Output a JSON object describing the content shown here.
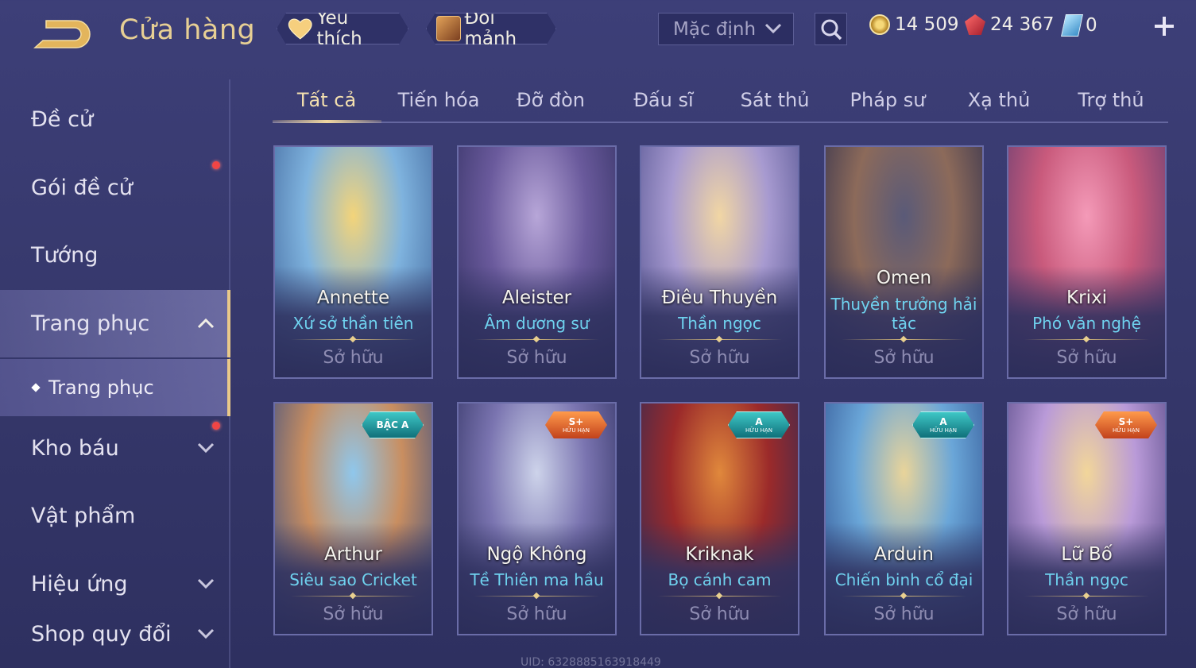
{
  "header": {
    "title": "Cửa hàng",
    "favorites_label": "Yêu thích",
    "exchange_label": "Đổi mảnh",
    "sort_value": "Mặc định",
    "gold": "14 509",
    "gems": "24 367",
    "vouchers": "0"
  },
  "sidebar": {
    "items": [
      {
        "label": "Đề cử"
      },
      {
        "label": "Gói đề cử"
      },
      {
        "label": "Tướng"
      },
      {
        "label": "Trang phục"
      },
      {
        "label": "Kho báu"
      },
      {
        "label": "Vật phẩm"
      },
      {
        "label": "Hiệu ứng"
      },
      {
        "label": "Shop quy đổi"
      }
    ],
    "subitem": "Trang phục"
  },
  "tabs": [
    "Tất cả",
    "Tiến hóa",
    "Đỡ đòn",
    "Đấu sĩ",
    "Sát thủ",
    "Pháp sư",
    "Xạ thủ",
    "Trợ thủ"
  ],
  "active_tab": "Tất cả",
  "cards": [
    {
      "hero": "Annette",
      "skin": "Xứ sở thần tiên",
      "status": "Sở hữu",
      "badge": null,
      "art": [
        "#f3d47a",
        "#7fb3de",
        "#3b5f96"
      ]
    },
    {
      "hero": "Aleister",
      "skin": "Âm dương sư",
      "status": "Sở hữu",
      "badge": null,
      "art": [
        "#b7a6d8",
        "#6a5a9c",
        "#2f2e5f"
      ]
    },
    {
      "hero": "Điêu Thuyền",
      "skin": "Thần ngọc",
      "status": "Sở hữu",
      "badge": null,
      "art": [
        "#f1d6a4",
        "#a79ad0",
        "#4b4c8a"
      ]
    },
    {
      "hero": "Omen",
      "skin": "Thuyền trưởng hải tặc",
      "status": "Sở hữu",
      "badge": null,
      "art": [
        "#5a5a78",
        "#8c6a5a",
        "#272a4c"
      ]
    },
    {
      "hero": "Krixi",
      "skin": "Phó văn nghệ",
      "status": "Sở hữu",
      "badge": null,
      "art": [
        "#f49ab8",
        "#c95a7c",
        "#5a3b70"
      ]
    },
    {
      "hero": "Arthur",
      "skin": "Siêu sao Cricket",
      "status": "Sở hữu",
      "badge": {
        "top": "BẬC A",
        "bottom": "",
        "color": "teal"
      },
      "art": [
        "#8fc7ec",
        "#c98e60",
        "#2f4a86"
      ]
    },
    {
      "hero": "Ngộ Không",
      "skin": "Tề Thiên ma hầu",
      "status": "Sở hữu",
      "badge": {
        "top": "S+",
        "bottom": "HỮU HẠN",
        "color": "orange"
      },
      "art": [
        "#cdd3ea",
        "#7a74b0",
        "#2a2c5c"
      ]
    },
    {
      "hero": "Kriknak",
      "skin": "Bọ cánh cam",
      "status": "Sở hữu",
      "badge": {
        "top": "A",
        "bottom": "HỮU HẠN",
        "color": "teal"
      },
      "art": [
        "#e0883c",
        "#9b2a2a",
        "#2a2a58"
      ]
    },
    {
      "hero": "Arduin",
      "skin": "Chiến binh cổ đại",
      "status": "Sở hữu",
      "badge": {
        "top": "A",
        "bottom": "HỮU HẠN",
        "color": "teal"
      },
      "art": [
        "#e9d49a",
        "#6aa6d8",
        "#2c4c8c"
      ]
    },
    {
      "hero": "Lữ Bố",
      "skin": "Thần ngọc",
      "status": "Sở hữu",
      "badge": {
        "top": "S+",
        "bottom": "HỮU HẠN",
        "color": "orange"
      },
      "art": [
        "#f2d69a",
        "#b99ad8",
        "#4a3f7c"
      ]
    }
  ],
  "uid": "UID: 6328885163918449",
  "colors": {
    "accent": "#e9c98a",
    "skin_text": "#6fd2ef",
    "notification": "#f04545"
  }
}
